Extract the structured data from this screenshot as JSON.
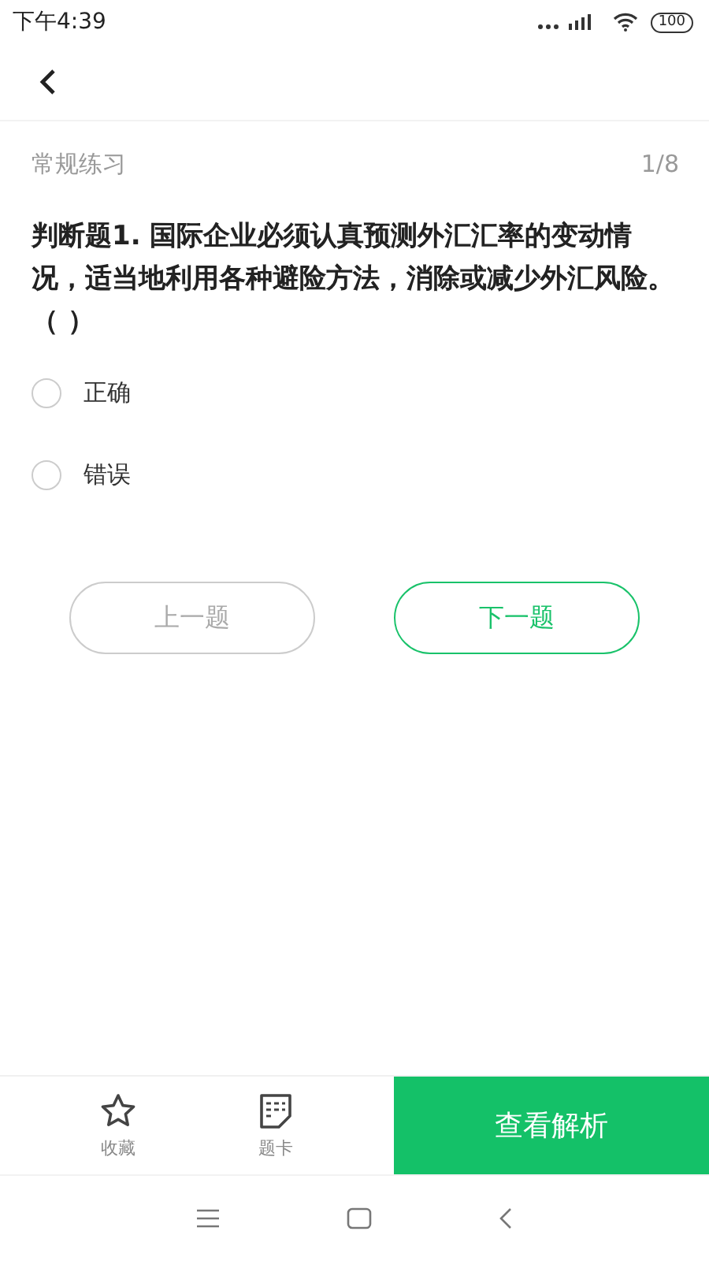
{
  "status_bar": {
    "time": "下午4:39",
    "battery": "100"
  },
  "header": {
    "section": "常规练习",
    "progress": "1/8"
  },
  "question": {
    "text": "判断题1. 国际企业必须认真预测外汇汇率的变动情况，适当地利用各种避险方法，消除或减少外汇风险。（ ）"
  },
  "options": [
    {
      "label": "正确",
      "selected": false
    },
    {
      "label": "错误",
      "selected": false
    }
  ],
  "nav_buttons": [
    {
      "label": "上一题",
      "disabled": true
    },
    {
      "label": "下一题",
      "disabled": false
    }
  ],
  "bottom_bar": {
    "items": [
      {
        "kind": "star",
        "label": "收藏"
      },
      {
        "kind": "card",
        "label": "题卡"
      }
    ],
    "action": "查看解析"
  }
}
